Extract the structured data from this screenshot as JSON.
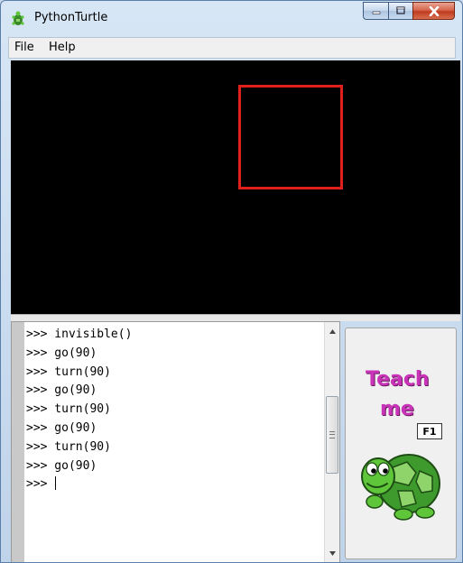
{
  "window": {
    "title": "PythonTurtle"
  },
  "menu": {
    "items": [
      "File",
      "Help"
    ]
  },
  "shell": {
    "lines": [
      ">>> invisible()",
      ">>> go(90)",
      ">>> turn(90)",
      ">>> go(90)",
      ">>> turn(90)",
      ">>> go(90)",
      ">>> turn(90)",
      ">>> go(90)"
    ],
    "prompt": ">>> "
  },
  "teach_button": {
    "line1": "Teach",
    "line2": "me",
    "shortcut": "F1"
  },
  "colors": {
    "canvas": "#000000",
    "square": "#e0201c",
    "teach_text": "#c833b8",
    "turtle": "#5fc63a"
  },
  "icons": [
    "turtle-app-icon",
    "minimize-icon",
    "maximize-icon",
    "close-icon",
    "scroll-up-arrow-icon",
    "scroll-down-arrow-icon",
    "turtle-mascot-icon"
  ]
}
